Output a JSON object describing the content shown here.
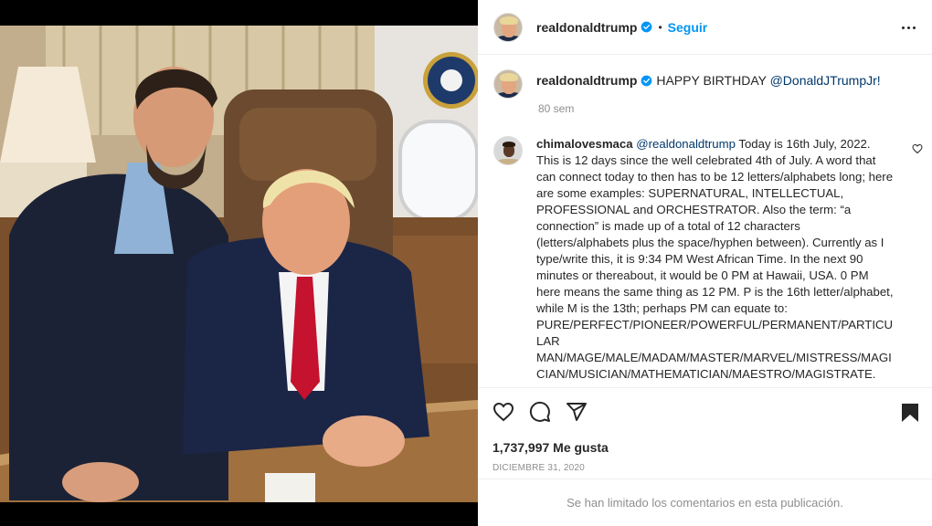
{
  "post": {
    "username": "realdonaldtrump",
    "follow_label": "Seguir",
    "separator": "•",
    "caption_text": "HAPPY BIRTHDAY ",
    "caption_mention": "@DonaldJTrumpJr!",
    "caption_time": "80 sem",
    "likes": "1,737,997 Me gusta",
    "date": "DICIEMBRE 31, 2020",
    "comments_limited": "Se han limitado los comentarios en esta publicación."
  },
  "comment": {
    "username": "chimalovesmaca",
    "mention": "@realdonaldtrump",
    "text": " Today is 16th July, 2022. This is 12 days since the well celebrated 4th of July. A word that can connect today to then has to be 12 letters/alphabets long; here are some examples: SUPERNATURAL, INTELLECTUAL, PROFESSIONAL and ORCHESTRATOR. Also the term: “a connection” is made up of a total of 12 characters (letters/alphabets plus the space/hyphen between). Currently as I type/write this, it is 9:34 PM West African Time. In the next 90 minutes or thereabout, it would be 0 PM at Hawaii, USA. 0 PM here means the same thing as 12 PM. P is the 16th letter/alphabet, while M is the 13th; perhaps PM can equate to: PURE/PERFECT/PIONEER/POWERFUL/PERMANENT/PARTICULAR MAN/MAGE/MALE/MADAM/MASTER/MARVEL/MISTRESS/MAGICIAN/MUSICIAN/MATHEMATICIAN/MAESTRO/MAGISTRATE."
  },
  "icons": {
    "more": "more-options-icon",
    "verified": "verified-badge-icon",
    "like": "heart-icon",
    "comment": "comment-icon",
    "share": "share-icon",
    "save": "bookmark-icon",
    "comment_like": "heart-small-icon"
  },
  "colors": {
    "accent": "#0095f6",
    "link": "#00376b",
    "muted": "#8e8e8e",
    "text": "#262626"
  }
}
